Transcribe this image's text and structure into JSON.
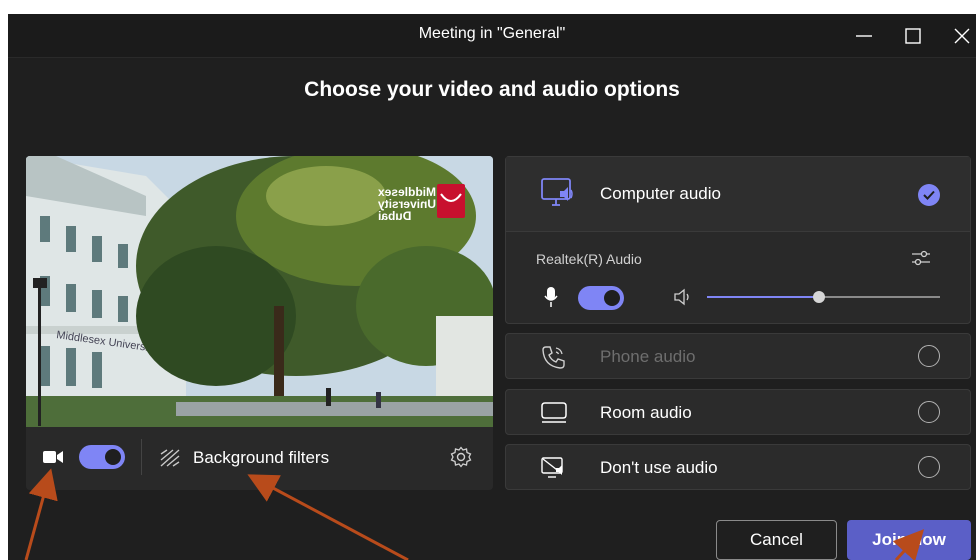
{
  "window": {
    "title": "Meeting in \"General\"",
    "controls": [
      "minimize-icon",
      "maximize-icon",
      "close-icon"
    ]
  },
  "heading": "Choose your video and audio options",
  "video": {
    "camera_on": true,
    "background_filters_label": "Background filters",
    "logo_text": "Middlesex\nUniversity\nDubai"
  },
  "audio": {
    "selected": "computer",
    "options": [
      {
        "key": "computer",
        "label": "Computer audio",
        "icon": "computer-speaker-icon",
        "enabled": true
      },
      {
        "key": "phone",
        "label": "Phone audio",
        "icon": "phone-icon",
        "enabled": false
      },
      {
        "key": "room",
        "label": "Room audio",
        "icon": "room-audio-icon",
        "enabled": true
      },
      {
        "key": "none",
        "label": "Don't use audio",
        "icon": "no-audio-icon",
        "enabled": true
      }
    ],
    "device_label": "Realtek(R) Audio",
    "mic_on": true,
    "speaker_volume": 0.48
  },
  "buttons": {
    "cancel": "Cancel",
    "join": "Join now"
  },
  "colors": {
    "accent": "#7f85f5",
    "join": "#5b5fc7",
    "annotation_arrow": "#b84b1b"
  }
}
